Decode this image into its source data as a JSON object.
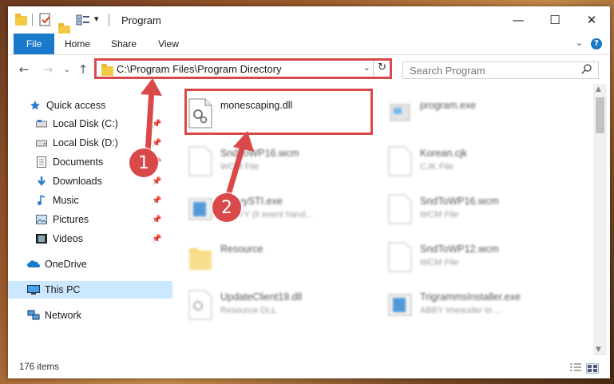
{
  "window": {
    "title": "Program",
    "controls": {
      "minimize": "—",
      "maximize": "☐",
      "close": "✕"
    }
  },
  "ribbon": {
    "tabs": [
      "File",
      "Home",
      "Share",
      "View"
    ],
    "help": "?"
  },
  "address": {
    "path": "C:\\Program Files\\Program Directory",
    "search_placeholder": "Search Program"
  },
  "sidebar": {
    "items": [
      {
        "label": "Quick access",
        "icon": "star-icon",
        "pinned": false
      },
      {
        "label": "Local Disk (C:)",
        "icon": "drive-icon",
        "pinned": true
      },
      {
        "label": "Local Disk (D:)",
        "icon": "drive-icon",
        "pinned": true
      },
      {
        "label": "Documents",
        "icon": "documents-icon",
        "pinned": true
      },
      {
        "label": "Downloads",
        "icon": "downloads-icon",
        "pinned": true
      },
      {
        "label": "Music",
        "icon": "music-icon",
        "pinned": true
      },
      {
        "label": "Pictures",
        "icon": "pictures-icon",
        "pinned": true
      },
      {
        "label": "Videos",
        "icon": "videos-icon",
        "pinned": true
      },
      {
        "label": "OneDrive",
        "icon": "onedrive-icon",
        "pinned": false
      },
      {
        "label": "This PC",
        "icon": "pc-icon",
        "pinned": false,
        "selected": true
      },
      {
        "label": "Network",
        "icon": "network-icon",
        "pinned": false
      }
    ]
  },
  "files": {
    "left": [
      {
        "name": "monescaping.dll",
        "type": ""
      },
      {
        "name": "SndToWP16.wcm",
        "type": "WCM File"
      },
      {
        "name": "AbbyySTI.exe",
        "type": "ABBYY (it event hand..."
      },
      {
        "name": "Resource",
        "type": ""
      },
      {
        "name": "UpdateClient19.dll",
        "type": "Resource DLL"
      }
    ],
    "right": [
      {
        "name": "program.exe",
        "type": ""
      },
      {
        "name": "Korean.cjk",
        "type": "CJK File"
      },
      {
        "name": "SndToWP16.wcm",
        "type": "WCM File"
      },
      {
        "name": "SndToWP12.wcm",
        "type": "WCM File"
      },
      {
        "name": "TrigrammsInstaller.exe",
        "type": "ABBY Imesuder to ..."
      }
    ]
  },
  "status": {
    "count": "176 items"
  },
  "callouts": {
    "one": "1",
    "two": "2"
  },
  "colors": {
    "accent": "#1979ca",
    "highlight": "#d9494a",
    "selected": "#cce8ff"
  }
}
